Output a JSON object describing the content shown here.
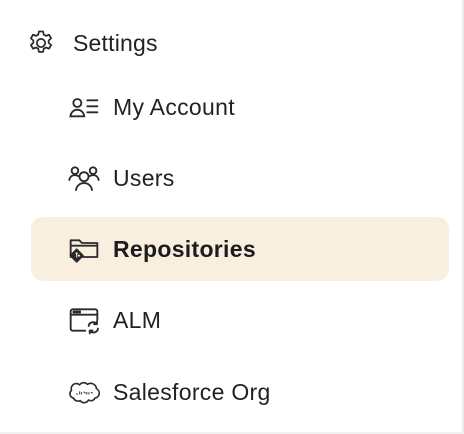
{
  "section": {
    "title": "Settings",
    "icon": "gear-icon"
  },
  "nav": {
    "items": [
      {
        "label": "My Account",
        "icon": "account-list-icon",
        "active": false
      },
      {
        "label": "Users",
        "icon": "users-icon",
        "active": false
      },
      {
        "label": "Repositories",
        "icon": "repository-icon",
        "active": true
      },
      {
        "label": "ALM",
        "icon": "alm-window-sync-icon",
        "active": false
      },
      {
        "label": "Salesforce Org",
        "icon": "salesforce-cloud-icon",
        "active": false
      }
    ]
  },
  "colors": {
    "active_background": "#f8efdf",
    "text": "#222222"
  }
}
